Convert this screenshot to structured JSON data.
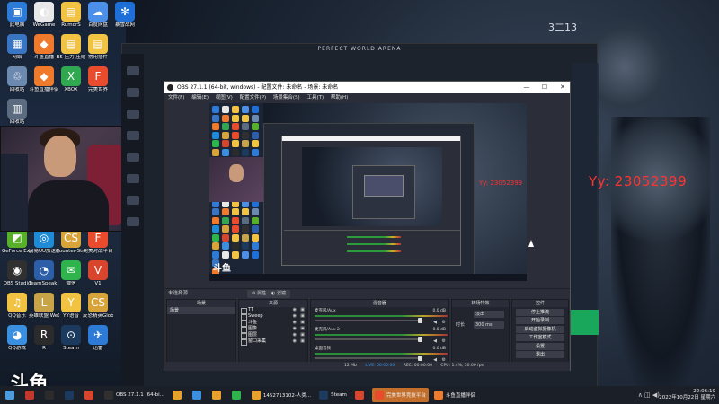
{
  "desktop": {
    "icons": [
      {
        "label": "此电脑",
        "color": "#2d7bd6",
        "glyph": "▣"
      },
      {
        "label": "WeGame",
        "color": "#e8e8e8",
        "glyph": "◐"
      },
      {
        "label": "RumorS",
        "color": "#f2c342",
        "glyph": "▤"
      },
      {
        "label": "百度网盘",
        "color": "#4b8fe8",
        "glyph": "☁"
      },
      {
        "label": "暴雪战网",
        "color": "#1e6fd8",
        "glyph": "✻"
      },
      {
        "label": "网络",
        "color": "#3a75c4",
        "glyph": "▦"
      },
      {
        "label": "斗鱼直播",
        "color": "#f07a2c",
        "glyph": "◆"
      },
      {
        "label": "B5 压力 压缩",
        "color": "#f2c342",
        "glyph": "▤"
      },
      {
        "label": "常用插件",
        "color": "#f2c342",
        "glyph": "▤"
      },
      {
        "label": "回收站",
        "color": "#6c8ab0",
        "glyph": "♲"
      },
      {
        "label": "斗鱼直播伴侣",
        "color": "#f07a2c",
        "glyph": "◆"
      },
      {
        "label": "XBOX",
        "color": "#2fa84f",
        "glyph": "X"
      },
      {
        "label": "完美世界",
        "color": "#e84c2c",
        "glyph": "F"
      },
      {
        "label": "回收站",
        "color": "#5b6b80",
        "glyph": "▥"
      },
      {
        "label": "GeForce Experience",
        "color": "#58b02a",
        "glyph": "◩"
      },
      {
        "label": "网易UU加速器",
        "color": "#1f8ad6",
        "glyph": "◎"
      },
      {
        "label": "Counter-Strike Global Off...",
        "color": "#d8a43a",
        "glyph": "CS"
      },
      {
        "label": "完美对战平台",
        "color": "#e84c2c",
        "glyph": "F"
      },
      {
        "label": "OBS Studio",
        "color": "#303030",
        "glyph": "◉"
      },
      {
        "label": "TeamSpeak 3",
        "color": "#2d5fa8",
        "glyph": "◔"
      },
      {
        "label": "微信",
        "color": "#2fb34c",
        "glyph": "✉"
      },
      {
        "label": "V1",
        "color": "#d8452c",
        "glyph": "V"
      },
      {
        "label": "QQ音乐",
        "color": "#f2c342",
        "glyph": "♫"
      },
      {
        "label": "英雄联盟 WeGame版",
        "color": "#c9a348",
        "glyph": "L"
      },
      {
        "label": "YY语音",
        "color": "#f2c342",
        "glyph": "Y"
      },
      {
        "label": "反恐精英Global Offensive",
        "color": "#d8a43a",
        "glyph": "CS"
      },
      {
        "label": "QQ游戏",
        "color": "#3a8fe0",
        "glyph": "◕"
      },
      {
        "label": "R",
        "color": "#2b2b2b",
        "glyph": "R"
      },
      {
        "label": "Steam",
        "color": "#1b3a5e",
        "glyph": "⊙"
      },
      {
        "label": "迅雷",
        "color": "#2d7bd6",
        "glyph": "✈"
      }
    ]
  },
  "arena": {
    "title": "PERFECT WORLD ARENA"
  },
  "top_right_number": "3二13",
  "watermark": "Yy: 23052399",
  "douyu_logo": "斗鱼",
  "preview_douyu": "斗鱼",
  "preview_watermark": "Yy: 23052399",
  "obs": {
    "title": "OBS 27.1.1 (64-bit, windows) - 配置文件: 未命名 - 场景: 未命名",
    "window_controls": [
      "—",
      "☐",
      "✕"
    ],
    "menu": [
      "文件(F)",
      "编辑(E)",
      "视图(V)",
      "配置文件(P)",
      "场景集合(S)",
      "工具(T)",
      "帮助(H)"
    ],
    "no_source": "未选择源",
    "properties_btn": "属性",
    "filters_btn": "滤镜",
    "docks": {
      "scenes_title": "场景",
      "sources_title": "来源",
      "mixer_title": "混音器",
      "transitions_title": "转场特效",
      "controls_title": "控件"
    },
    "scenes": [
      "场景"
    ],
    "sources": [
      "TT",
      "Sweep",
      "斗鱼",
      "图像",
      "图层",
      "窗口采集"
    ],
    "mixer": [
      {
        "name": "麦克风/Aux",
        "db": "0.0 dB"
      },
      {
        "name": "麦克风/Aux 2",
        "db": "0.0 dB"
      },
      {
        "name": "桌面音频",
        "db": "0.0 dB"
      }
    ],
    "transition": {
      "select": "淡出",
      "duration_label": "时长",
      "duration": "300 ms"
    },
    "controls": [
      "停止推流",
      "开始录制",
      "启动虚拟摄像机",
      "工作室模式",
      "设置",
      "退出"
    ],
    "dock_foot_icons": [
      "+",
      "−",
      "∧",
      "∨"
    ],
    "source_foot_icons": [
      "+",
      "−",
      "⚙",
      "∧",
      "∨"
    ],
    "status": {
      "dropped": "LIVE: 00:00:00",
      "rec": "REC: 00:00:00",
      "cpu": "CPU: 1.4%, 30.00 fps",
      "kbps": "12 Mb"
    }
  },
  "taskbar": {
    "items": [
      {
        "label": "",
        "color": "#c0392b"
      },
      {
        "label": "",
        "color": "#2b2b2b"
      },
      {
        "label": "",
        "color": "#1b3a5e"
      },
      {
        "label": "",
        "color": "#d8452c"
      },
      {
        "label": "OBS 27.1.1 (64-bi...",
        "color": "#303030"
      },
      {
        "label": "",
        "color": "#e8a12c"
      },
      {
        "label": "",
        "color": "#3a8fe0"
      },
      {
        "label": "",
        "color": "#e8a12c"
      },
      {
        "label": "",
        "color": "#2fb34c"
      },
      {
        "label": "1452713102-人类...",
        "color": "#e8a12c"
      },
      {
        "label": "Steam",
        "color": "#1b3a5e"
      },
      {
        "label": "",
        "color": "#d8452c"
      },
      {
        "label": "完美世界竞技平台",
        "color": "#e84c2c",
        "active": true
      },
      {
        "label": "斗鱼直播伴侣",
        "color": "#f07a2c"
      }
    ],
    "clock_time": "22:06:19",
    "clock_date": "2022年10月22日 星期六"
  }
}
